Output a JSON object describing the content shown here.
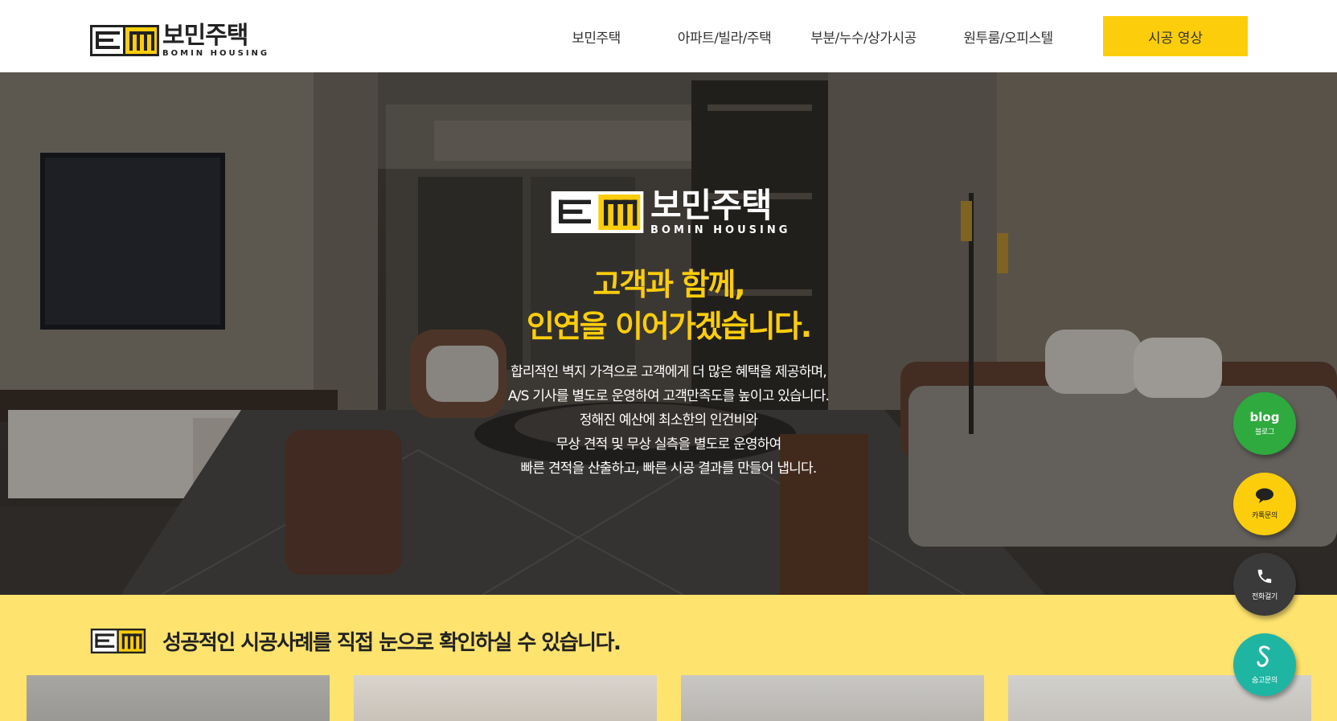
{
  "header": {
    "logo_ko": "보민주택",
    "logo_en": "BOMIN HOUSING",
    "nav": [
      "보민주택",
      "아파트/빌라/주택",
      "부분/누수/상가시공",
      "원투룸/오피스텔"
    ],
    "cta": "시공 영상"
  },
  "hero": {
    "logo_ko": "보민주택",
    "logo_en": "BOMIN HOUSING",
    "title_line1": "고객과 함께,",
    "title_line2": "인연을 이어가겠습니다.",
    "desc": [
      "합리적인 벽지 가격으로 고객에게 더 많은 혜택을 제공하며,",
      "A/S 기사를 별도로 운영하여 고객만족도를 높이고 있습니다.",
      "정해진 예산에 최소한의 인건비와",
      "무상 견적 및 무상 실측을 별도로 운영하여",
      "빠른 견적을 산출하고, 빠른 시공 결과를 만들어 냅니다."
    ]
  },
  "section": {
    "title": "성공적인 시공사례를 직접 눈으로 확인하실 수 있습니다."
  },
  "floating": {
    "blog_word": "blog",
    "blog_label": "블로그",
    "kakao_label": "카톡문의",
    "call_label": "전화걸기",
    "soomgo_label": "숨고문의"
  },
  "colors": {
    "accent_yellow": "#fccd0a",
    "section_bg": "#fee36e",
    "blog_green": "#2eaa3e",
    "call_dark": "#3a3a3a",
    "soomgo_teal": "#1fb5a3"
  },
  "icons": [
    "bomin-logo-icon",
    "speech-bubble-icon",
    "phone-icon",
    "soomgo-s-icon"
  ]
}
